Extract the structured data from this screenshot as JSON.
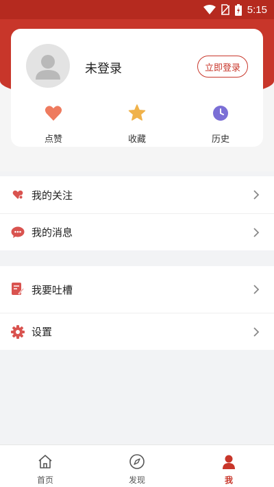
{
  "status_bar": {
    "time": "5:15"
  },
  "profile": {
    "name": "未登录",
    "login_label": "立即登录"
  },
  "quick_actions": [
    {
      "label": "点赞",
      "icon": "heart-icon"
    },
    {
      "label": "收藏",
      "icon": "star-icon"
    },
    {
      "label": "历史",
      "icon": "clock-icon"
    }
  ],
  "menu": {
    "group1": [
      {
        "label": "我的关注",
        "icon": "heart-follow-icon"
      },
      {
        "label": "我的消息",
        "icon": "message-icon"
      }
    ],
    "group2": [
      {
        "label": "我要吐槽",
        "icon": "feedback-icon"
      },
      {
        "label": "设置",
        "icon": "gear-icon"
      }
    ]
  },
  "tabbar": [
    {
      "label": "首页",
      "icon": "home-icon",
      "active": false
    },
    {
      "label": "发现",
      "icon": "compass-icon",
      "active": false
    },
    {
      "label": "我",
      "icon": "person-icon",
      "active": true
    }
  ],
  "colors": {
    "accent": "#c8362a",
    "star": "#f0b24a",
    "clock": "#7b6fd6",
    "heart": "#ee7b5f"
  }
}
